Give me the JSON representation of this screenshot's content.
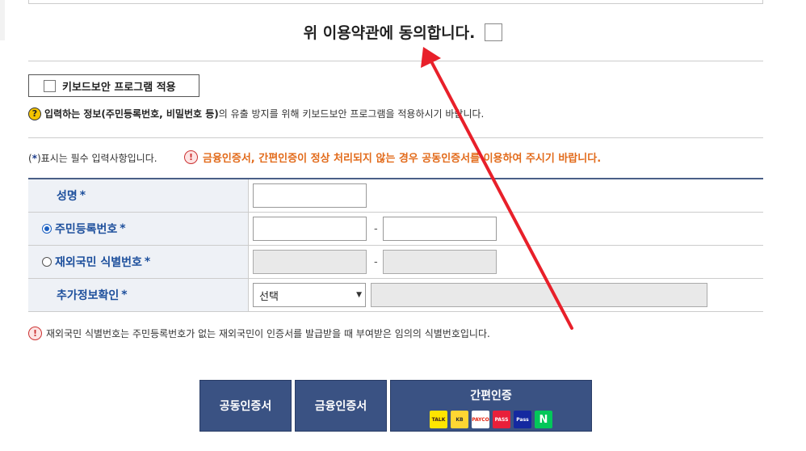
{
  "agree": {
    "label": "위 이용약관에 동의합니다."
  },
  "keyboard": {
    "label": "키보드보안 프로그램 적용"
  },
  "info": {
    "icon": "?",
    "bold_part": "입력하는 정보(주민등록번호, 비밀번호 등)",
    "rest": "의 유출 방지를 위해 키보드보안 프로그램을 적용하시기 바랍니다."
  },
  "required_note": {
    "open": "(",
    "star": "*",
    "close": ")",
    "text": "표시는 필수 입력사항입니다."
  },
  "warning": {
    "icon": "!",
    "text": "금융인증서, 간편인증이 정상 처리되지 않는 경우 공동인증서를 이용하여 주시기 바랍니다."
  },
  "form": {
    "name_label": "성명",
    "rrn_label": "주민등록번호",
    "foreign_label": "재외국민 식별번호",
    "extra_label": "추가정보확인",
    "star": "*",
    "dash": "-",
    "select_value": "선택",
    "select_arrow": "▼"
  },
  "note": {
    "icon": "!",
    "text": "재외국민 식별번호는 주민등록번호가 없는 재외국민이 인증서를 발급받을 때 부여받은 임의의 식별번호입니다."
  },
  "buttons": {
    "joint": "공동인증서",
    "financial": "금융인증서",
    "simple": "간편인증"
  },
  "simple_logos": [
    {
      "text": "TALK",
      "bg": "#ffe500",
      "fg": "#3a1d1d"
    },
    {
      "text": "KB",
      "bg": "#ffd633",
      "fg": "#333"
    },
    {
      "text": "PAYCO",
      "bg": "#ffffff",
      "fg": "#e42313"
    },
    {
      "text": "PASS",
      "bg": "#e8203a",
      "fg": "#ffffff"
    },
    {
      "text": "Pass",
      "bg": "#1428a0",
      "fg": "#ffffff"
    },
    {
      "text": "N",
      "bg": "#03c75a",
      "fg": "#ffffff"
    }
  ],
  "colors": {
    "accent": "#3a5283",
    "warning": "#e26b1b",
    "arrow": "#e8202a"
  }
}
